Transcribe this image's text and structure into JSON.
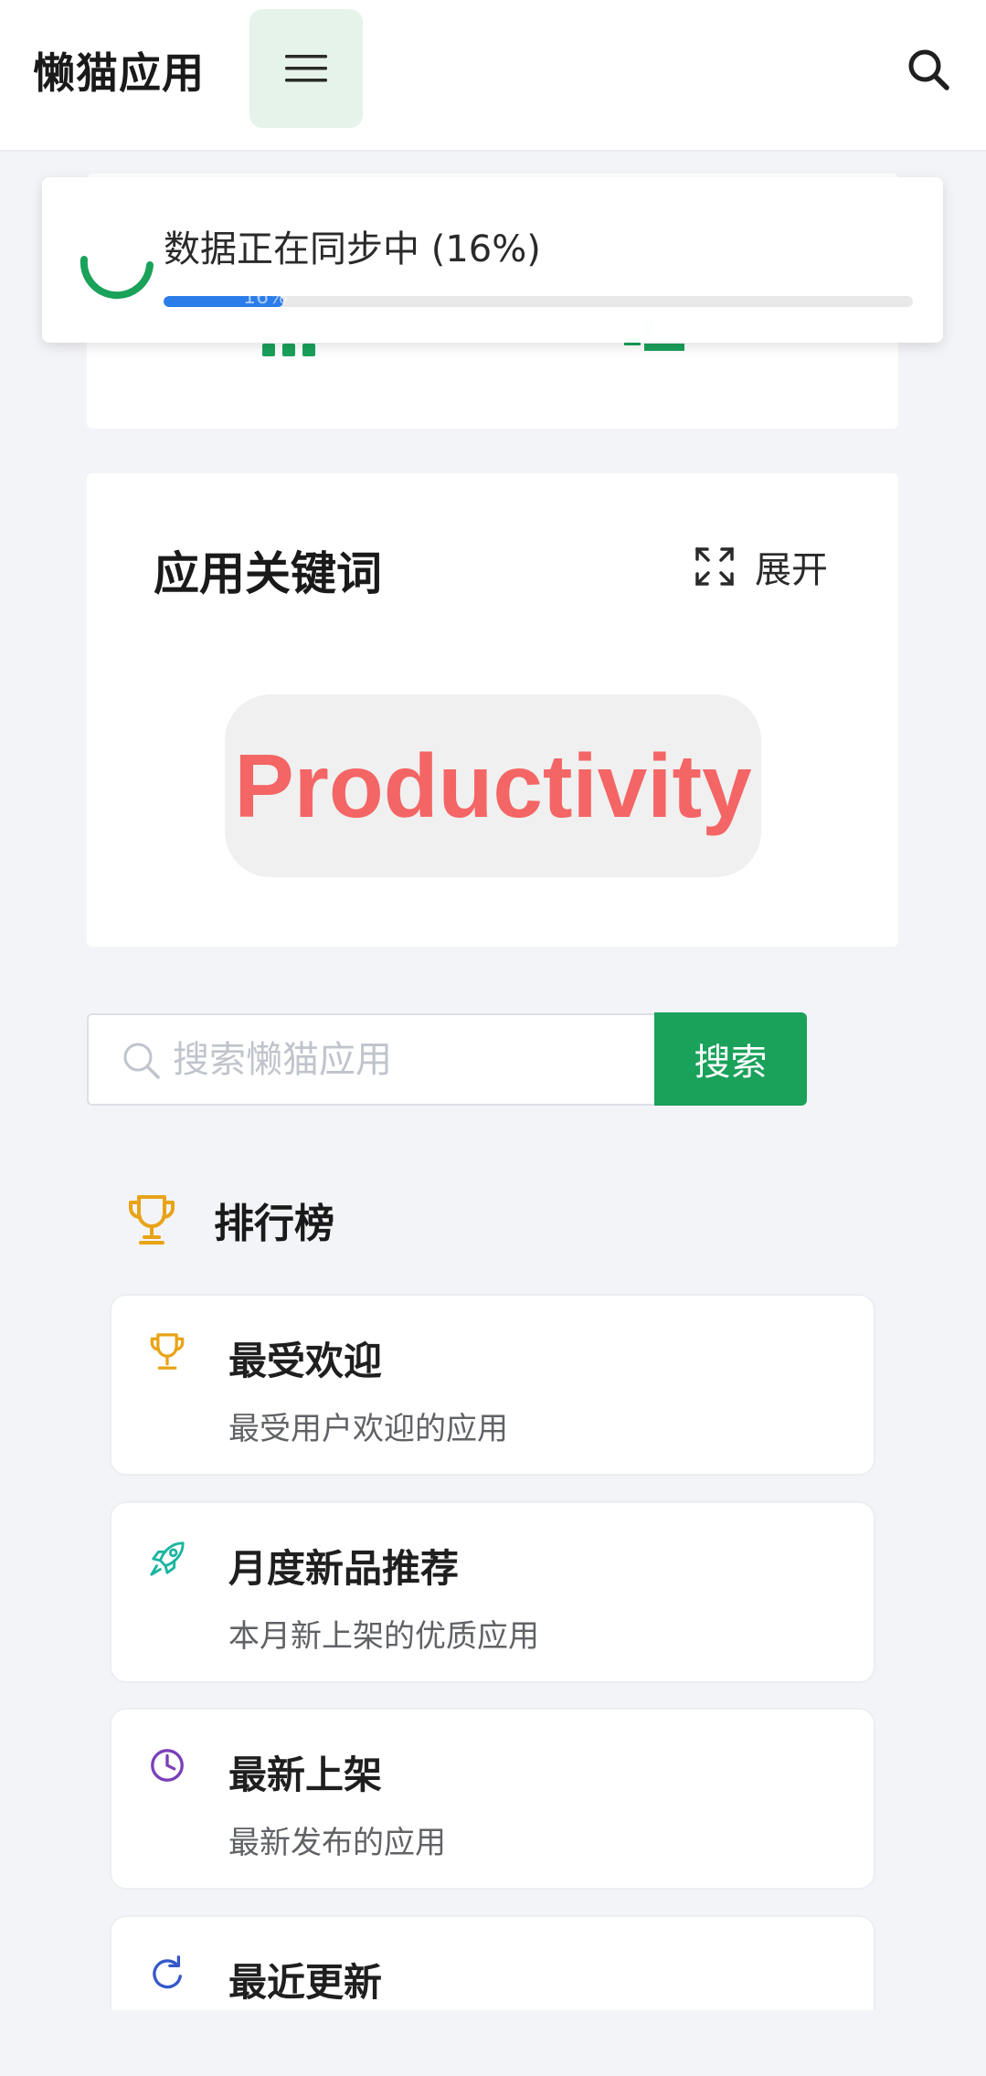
{
  "header": {
    "title": "懒猫应用",
    "menu_icon": "hamburger-menu-icon",
    "search_icon": "search-icon"
  },
  "toast": {
    "message": "数据正在同步中 (16%)",
    "progress": 0.16,
    "progress_label": "16%",
    "spinner_color": "#1aa15a",
    "bar_color": "#2b7de9"
  },
  "keywords": {
    "title": "应用关键词",
    "expand_label": "展开",
    "chip": "Productivity",
    "chip_color": "#f46565"
  },
  "search": {
    "placeholder": "搜索懒猫应用",
    "button_label": "搜索",
    "button_color": "#1aa15a"
  },
  "rankings": {
    "title": "排行榜",
    "items": [
      {
        "title": "最受欢迎",
        "desc": "最受用户欢迎的应用",
        "icon": "trophy-icon",
        "color": "#e8a317"
      },
      {
        "title": "月度新品推荐",
        "desc": "本月新上架的优质应用",
        "icon": "rocket-icon",
        "color": "#1bb5a0"
      },
      {
        "title": "最新上架",
        "desc": "最新发布的应用",
        "icon": "clock-icon",
        "color": "#7b3fb8"
      },
      {
        "title": "最近更新",
        "desc": "",
        "icon": "refresh-icon",
        "color": "#3558c9"
      }
    ]
  }
}
